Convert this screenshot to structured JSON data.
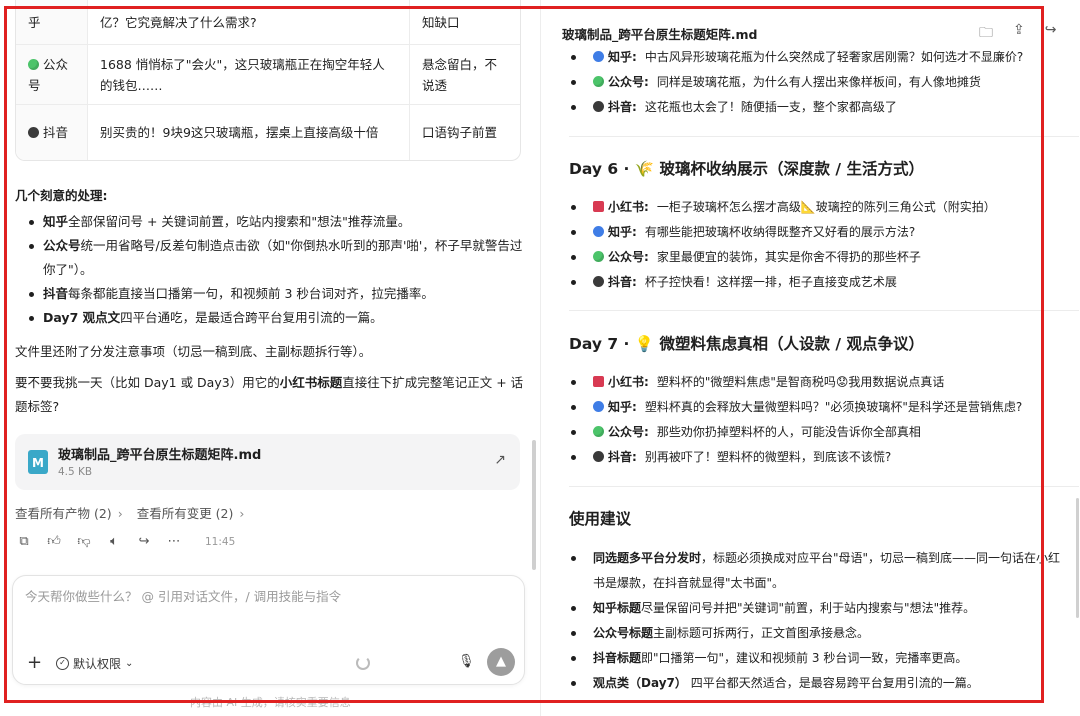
{
  "left": {
    "table": {
      "rows": [
        {
          "platform": "乎",
          "icon": "",
          "title": "亿？它究竟解决了什么需求?",
          "note": "知缺口"
        },
        {
          "platform": "公众号",
          "icon": "green",
          "title": "1688 悄悄标了\"会火\"，这只玻璃瓶正在掏空年轻人的钱包……",
          "note": "悬念留白，不说透"
        },
        {
          "platform": "抖音",
          "icon": "black",
          "title": "别买贵的！9块9这只玻璃瓶，摆桌上直接高级十倍",
          "note": "口语钩子前置"
        }
      ]
    },
    "notes_heading": "几个刻意的处理:",
    "notes": [
      {
        "bold": "知乎",
        "text": "全部保留问号 + 关键词前置，吃站内搜索和\"想法\"推荐流量。"
      },
      {
        "bold": "公众号",
        "text": "统一用省略号/反差句制造点击欲（如\"你倒热水听到的那声'啪'，杯子早就警告过你了\"）。"
      },
      {
        "bold": "抖音",
        "text": "每条都能直接当口播第一句，和视频前 3 秒台词对齐，拉完播率。"
      },
      {
        "bold": "Day7 观点文",
        "text": "四平台通吃，是最适合跨平台复用引流的一篇。"
      }
    ],
    "para1": "文件里还附了分发注意事项（切忌一稿到底、主副标题拆行等）。",
    "para2_pre": "要不要我挑一天（比如 Day1 或 Day3）用它的",
    "para2_bold": "小红书标题",
    "para2_post": "直接往下扩成完整笔记正文 + 话题标签?",
    "file": {
      "icon_letter": "M",
      "name": "玻璃制品_跨平台原生标题矩阵.md",
      "size": "4.5 KB"
    },
    "links": {
      "artifacts": "查看所有产物 (2)",
      "changes": "查看所有变更 (2)"
    },
    "time": "11:45",
    "composer": {
      "placeholder": "今天帮你做些什么？ @ 引用对话文件，/ 调用技能与指令",
      "permission": "默认权限"
    },
    "disclaimer": "内容由 AI 生成，请核实重要信息"
  },
  "right": {
    "file_title": "玻璃制品_跨平台原生标题矩阵.md",
    "top_list": [
      {
        "icon": "blue",
        "platform": "知乎:",
        "text": "中古风异形玻璃花瓶为什么突然成了轻奢家居刚需？如何选才不显廉价?"
      },
      {
        "icon": "green",
        "platform": "公众号:",
        "text": "同样是玻璃花瓶，为什么有人摆出来像样板间，有人像地摊货"
      },
      {
        "icon": "black",
        "platform": "抖音:",
        "text": "这花瓶也太会了！随便插一支，整个家都高级了"
      }
    ],
    "day6": {
      "title": "Day 6 · 🌾 玻璃杯收纳展示（深度款 / 生活方式）",
      "items": [
        {
          "icon": "red",
          "platform": "小红书:",
          "text": "一柜子玻璃杯怎么摆才高级📐玻璃控的陈列三角公式（附实拍）"
        },
        {
          "icon": "blue",
          "platform": "知乎:",
          "text": "有哪些能把玻璃杯收纳得既整齐又好看的展示方法?"
        },
        {
          "icon": "green",
          "platform": "公众号:",
          "text": "家里最便宜的装饰，其实是你舍不得扔的那些杯子"
        },
        {
          "icon": "black",
          "platform": "抖音:",
          "text": "杯子控快看！这样摆一排，柜子直接变成艺术展"
        }
      ]
    },
    "day7": {
      "title": "Day 7 · 💡 微塑料焦虑真相（人设款 / 观点争议）",
      "items": [
        {
          "icon": "red",
          "platform": "小红书:",
          "text": "塑料杯的\"微塑料焦虑\"是智商税吗😟我用数据说点真话"
        },
        {
          "icon": "blue",
          "platform": "知乎:",
          "text": "塑料杯真的会释放大量微塑料吗？\"必须换玻璃杯\"是科学还是营销焦虑?"
        },
        {
          "icon": "green",
          "platform": "公众号:",
          "text": "那些劝你扔掉塑料杯的人，可能没告诉你全部真相"
        },
        {
          "icon": "black",
          "platform": "抖音:",
          "text": "别再被吓了！塑料杯的微塑料，到底该不该慌?"
        }
      ]
    },
    "tips_title": "使用建议",
    "tips": [
      {
        "bold": "同选题多平台分发时",
        "text": "，标题必须换成对应平台\"母语\"，切忌一稿到底——同一句话在小红书是爆款，在抖音就显得\"太书面\"。"
      },
      {
        "bold": "知乎标题",
        "text": "尽量保留问号并把\"关键词\"前置，利于站内搜索与\"想法\"推荐。"
      },
      {
        "bold": "公众号标题",
        "text": "主副标题可拆两行，正文首图承接悬念。"
      },
      {
        "bold": "抖音标题",
        "text": "即\"口播第一句\"，建议和视频前 3 秒台词一致，完播率更高。"
      },
      {
        "bold": "观点类（Day7）",
        "text": " 四平台都天然适合，是最容易跨平台复用引流的一篇。"
      }
    ]
  },
  "colors": {
    "frame": "#e02020",
    "green": "#4cc46a",
    "blue": "#3f7de6",
    "black": "#3a3a3a",
    "red": "#d83a52"
  }
}
